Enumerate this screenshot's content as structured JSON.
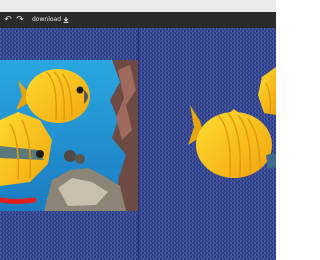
{
  "toolbar": {
    "undo_icon": "undo-icon",
    "redo_icon": "redo-icon",
    "download_label": "download",
    "download_icon": "download-icon"
  },
  "colors": {
    "toolbar_bg": "#2b2b2b",
    "canvas_checker_light": "#3c4e96",
    "canvas_checker_dark": "#2b3b87",
    "fish_yellow": "#f7c21a",
    "water_blue": "#1e9fd9",
    "brush_red": "#e0201c"
  }
}
